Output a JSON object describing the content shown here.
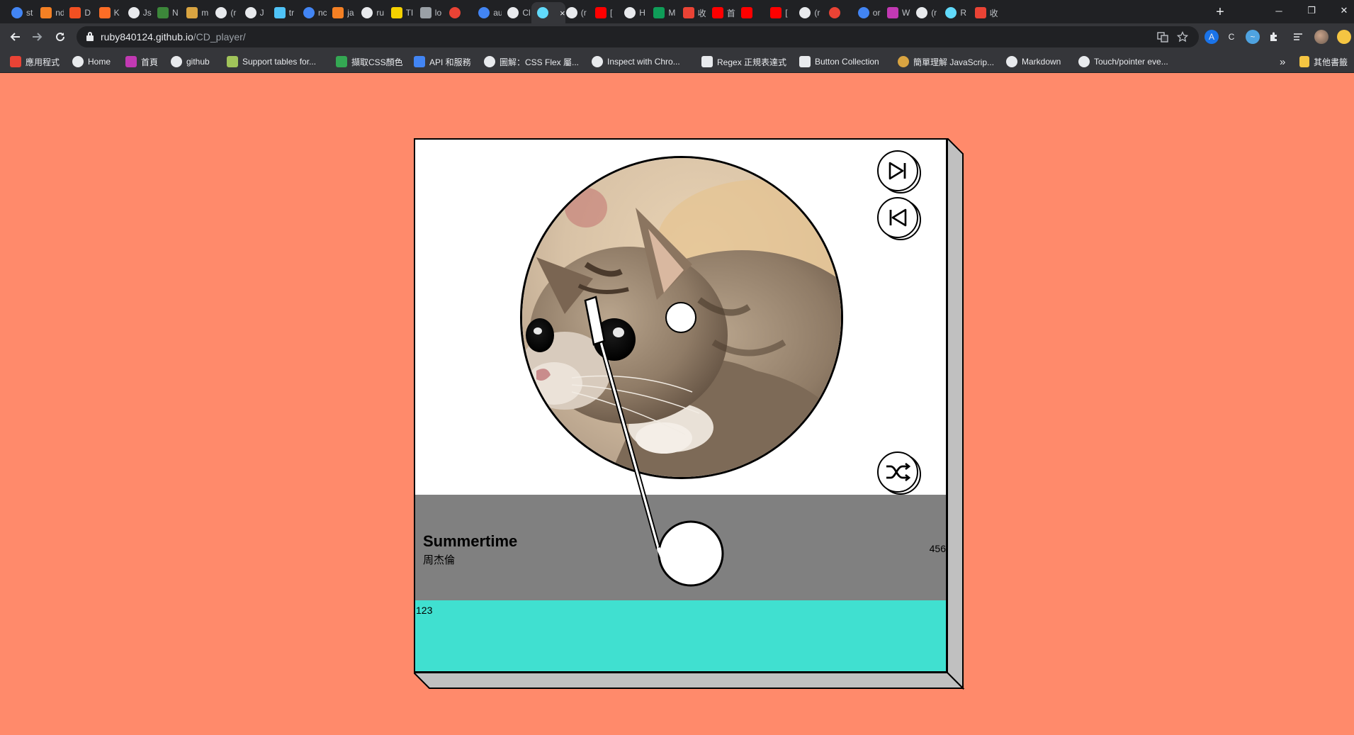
{
  "browser": {
    "tabs": [
      {
        "label": "st",
        "favicon": "google-icon",
        "color": "#4285F4"
      },
      {
        "label": "nd",
        "favicon": "fire-icon",
        "color": "#f48024"
      },
      {
        "label": "D",
        "favicon": "microsoft-icon",
        "color": "#f25022"
      },
      {
        "label": "K",
        "favicon": "gitlab-icon",
        "color": "#fc6d26"
      },
      {
        "label": "Js",
        "favicon": "github-icon",
        "color": "#e8eaed"
      },
      {
        "label": "N",
        "favicon": "node-icon",
        "color": "#3c873a"
      },
      {
        "label": "m",
        "favicon": "burger-icon",
        "color": "#d9a441"
      },
      {
        "label": "(r",
        "favicon": "gear-icon",
        "color": "#e8eaed"
      },
      {
        "label": "J",
        "favicon": "gear-icon",
        "color": "#e8eaed"
      },
      {
        "label": "tr",
        "favicon": "bookmark-icon",
        "color": "#4fc3f7"
      },
      {
        "label": "nc",
        "favicon": "google-icon",
        "color": "#4285F4"
      },
      {
        "label": "ja",
        "favicon": "fire-icon",
        "color": "#f48024"
      },
      {
        "label": "ru",
        "favicon": "github-icon",
        "color": "#e8eaed"
      },
      {
        "label": "TI",
        "favicon": "tutorial-icon",
        "color": "#f5d100"
      },
      {
        "label": "lo",
        "favicon": "grid-icon",
        "color": "#9aa0a6"
      },
      {
        "label": "",
        "favicon": "record-icon",
        "color": "#ea4335"
      },
      {
        "label": "au",
        "favicon": "google-icon",
        "color": "#4285F4"
      },
      {
        "label": "Cl",
        "favicon": "github-icon",
        "color": "#e8eaed"
      },
      {
        "label": "",
        "favicon": "react-icon",
        "color": "#61dafb",
        "active": true,
        "close": "×"
      },
      {
        "label": "(r",
        "favicon": "gear-icon",
        "color": "#e8eaed"
      },
      {
        "label": "[",
        "favicon": "youtube-icon",
        "color": "#ff0000"
      },
      {
        "label": "H",
        "favicon": "gear-icon",
        "color": "#e8eaed"
      },
      {
        "label": "M",
        "favicon": "sheets-icon",
        "color": "#0f9d58"
      },
      {
        "label": "收",
        "favicon": "gmail-icon",
        "color": "#ea4335"
      },
      {
        "label": "首",
        "favicon": "youtube-icon",
        "color": "#ff0000"
      },
      {
        "label": "",
        "favicon": "youtube-icon",
        "color": "#ff0000"
      },
      {
        "label": "[",
        "favicon": "youtube-icon",
        "color": "#ff0000"
      },
      {
        "label": "(r",
        "favicon": "gear-icon",
        "color": "#e8eaed"
      },
      {
        "label": "",
        "favicon": "record-icon",
        "color": "#ea4335"
      },
      {
        "label": "or",
        "favicon": "google-icon",
        "color": "#4285F4"
      },
      {
        "label": "W",
        "favicon": "p-icon",
        "color": "#c239b3"
      },
      {
        "label": "(r",
        "favicon": "gear-icon",
        "color": "#e8eaed"
      },
      {
        "label": "R",
        "favicon": "react-icon",
        "color": "#61dafb"
      },
      {
        "label": "收",
        "favicon": "gmail-icon",
        "color": "#ea4335"
      }
    ],
    "new_tab": "+",
    "window_controls": {
      "minimize": "─",
      "restore": "❐",
      "close": "✕"
    },
    "url_host": "ruby840124.github.io",
    "url_path": "/CD_player/",
    "bookmarks": [
      {
        "label": "應用程式",
        "icon": "apps-grid-icon",
        "color": "#ea4335"
      },
      {
        "label": "Home",
        "icon": "gear-icon",
        "color": "#e8eaed"
      },
      {
        "label": "首頁",
        "icon": "p-icon",
        "color": "#c239b3"
      },
      {
        "label": "github",
        "icon": "github-icon",
        "color": "#e8eaed"
      },
      {
        "label": "Support tables for...",
        "icon": "caniuse-icon",
        "color": "#a1c45a"
      },
      {
        "label": "擷取CSS顏色",
        "icon": "g-icon",
        "color": "#34a853"
      },
      {
        "label": "API 和服務",
        "icon": "api-icon",
        "color": "#4285F4"
      },
      {
        "label": "圖解：CSS Flex 屬...",
        "icon": "globe-icon",
        "color": "#e8eaed"
      },
      {
        "label": "Inspect with Chro...",
        "icon": "globe-icon",
        "color": "#e8eaed"
      },
      {
        "label": "Regex 正規表達式",
        "icon": "medium-icon",
        "color": "#e8eaed"
      },
      {
        "label": "Button Collection",
        "icon": "codepen-icon",
        "color": "#e8eaed"
      },
      {
        "label": "簡單理解 JavaScrip...",
        "icon": "circle-icon",
        "color": "#d9a441"
      },
      {
        "label": "Markdown",
        "icon": "github-icon",
        "color": "#e8eaed"
      },
      {
        "label": "Touch/pointer eve...",
        "icon": "globe-icon",
        "color": "#e8eaed"
      }
    ],
    "more_bookmarks": "»",
    "other_bookmarks": "其他書籤"
  },
  "player": {
    "song_title": "Summertime",
    "artist": "周杰倫",
    "track_number": "456",
    "elapsed": "123",
    "buttons": {
      "next": "skip-next-icon",
      "previous": "skip-previous-icon",
      "shuffle": "shuffle-icon"
    },
    "cover": "kitten-photo",
    "colors": {
      "page_background": "#FF8A6B",
      "info_band": "#808080",
      "progress_band": "#40E0D0",
      "side_shadow": "#C0C0C0"
    }
  }
}
